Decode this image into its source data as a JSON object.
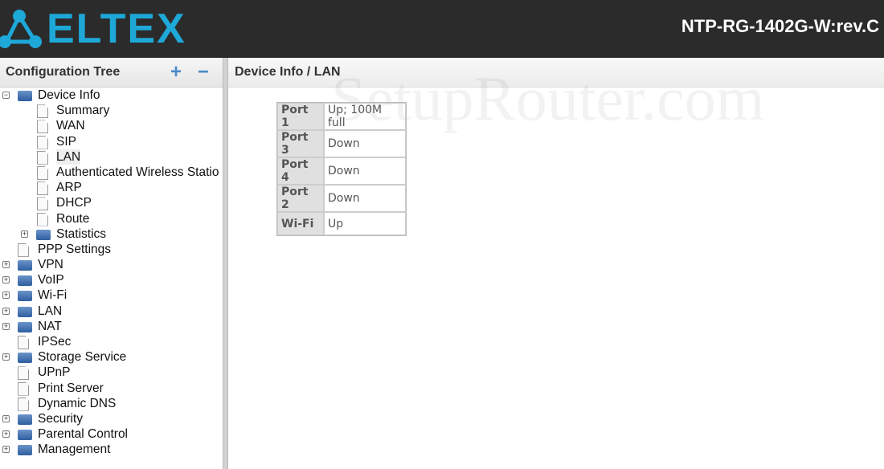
{
  "header": {
    "logo_text": "ELTEX",
    "model": "NTP-RG-1402G-W:rev.C",
    "brand_color": "#1ea8d8"
  },
  "sidebar": {
    "title": "Configuration Tree",
    "expand_all_icon": "plus-icon",
    "collapse_all_icon": "minus-icon",
    "items": [
      {
        "label": "Device Info",
        "level": 0,
        "type": "folder",
        "state": "expanded"
      },
      {
        "label": "Summary",
        "level": 1,
        "type": "page"
      },
      {
        "label": "WAN",
        "level": 1,
        "type": "page"
      },
      {
        "label": "SIP",
        "level": 1,
        "type": "page"
      },
      {
        "label": "LAN",
        "level": 1,
        "type": "page",
        "selected": true
      },
      {
        "label": "Authenticated Wireless Statio",
        "level": 1,
        "type": "page"
      },
      {
        "label": "ARP",
        "level": 1,
        "type": "page"
      },
      {
        "label": "DHCP",
        "level": 1,
        "type": "page"
      },
      {
        "label": "Route",
        "level": 1,
        "type": "page"
      },
      {
        "label": "Statistics",
        "level": 1,
        "type": "folder",
        "state": "collapsed"
      },
      {
        "label": "PPP Settings",
        "level": 0,
        "type": "page"
      },
      {
        "label": "VPN",
        "level": 0,
        "type": "folder",
        "state": "collapsed"
      },
      {
        "label": "VoIP",
        "level": 0,
        "type": "folder",
        "state": "collapsed"
      },
      {
        "label": "Wi-Fi",
        "level": 0,
        "type": "folder",
        "state": "collapsed"
      },
      {
        "label": "LAN",
        "level": 0,
        "type": "folder",
        "state": "collapsed"
      },
      {
        "label": "NAT",
        "level": 0,
        "type": "folder",
        "state": "collapsed"
      },
      {
        "label": "IPSec",
        "level": 0,
        "type": "page"
      },
      {
        "label": "Storage Service",
        "level": 0,
        "type": "folder",
        "state": "collapsed"
      },
      {
        "label": "UPnP",
        "level": 0,
        "type": "page"
      },
      {
        "label": "Print Server",
        "level": 0,
        "type": "page"
      },
      {
        "label": "Dynamic DNS",
        "level": 0,
        "type": "page"
      },
      {
        "label": "Security",
        "level": 0,
        "type": "folder",
        "state": "collapsed"
      },
      {
        "label": "Parental Control",
        "level": 0,
        "type": "folder",
        "state": "collapsed"
      },
      {
        "label": "Management",
        "level": 0,
        "type": "folder",
        "state": "collapsed"
      }
    ]
  },
  "main": {
    "breadcrumb": "Device Info / LAN",
    "watermark": "SetupRouter.com",
    "ports": [
      {
        "name": "Port 1",
        "status": "Up; 100M full"
      },
      {
        "name": "Port 3",
        "status": "Down"
      },
      {
        "name": "Port 4",
        "status": "Down"
      },
      {
        "name": "Port 2",
        "status": "Down"
      },
      {
        "name": "Wi-Fi",
        "status": "Up"
      }
    ]
  }
}
